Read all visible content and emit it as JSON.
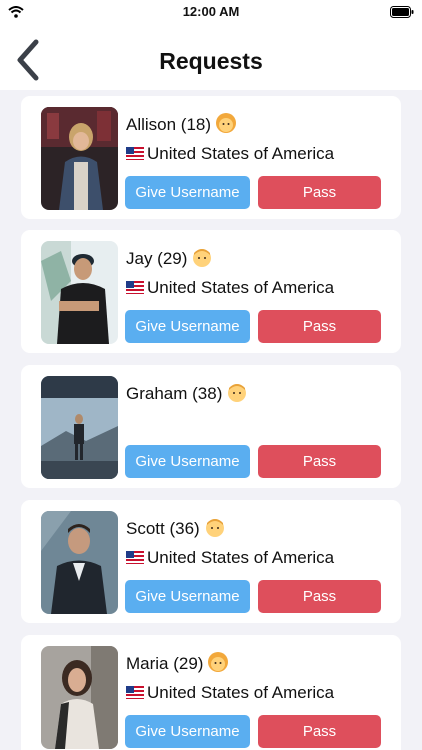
{
  "status_bar": {
    "time": "12:00 AM"
  },
  "header": {
    "title": "Requests"
  },
  "colors": {
    "give_button": "#5aaef0",
    "pass_button": "#de4f5c"
  },
  "requests": [
    {
      "name_age": "Allison (18)",
      "emoji": "woman-emoji",
      "country": "United States of America",
      "flag": "us-flag",
      "give_label": "Give Username",
      "pass_label": "Pass"
    },
    {
      "name_age": "Jay (29)",
      "emoji": "man-emoji",
      "country": "United States of America",
      "flag": "us-flag",
      "give_label": "Give Username",
      "pass_label": "Pass"
    },
    {
      "name_age": "Graham (38)",
      "emoji": "man-emoji",
      "country": "",
      "flag": "",
      "give_label": "Give Username",
      "pass_label": "Pass"
    },
    {
      "name_age": "Scott (36)",
      "emoji": "man-emoji",
      "country": "United States of America",
      "flag": "us-flag",
      "give_label": "Give Username",
      "pass_label": "Pass"
    },
    {
      "name_age": "Maria (29)",
      "emoji": "woman-emoji",
      "country": "United States of America",
      "flag": "us-flag",
      "give_label": "Give Username",
      "pass_label": "Pass"
    }
  ]
}
